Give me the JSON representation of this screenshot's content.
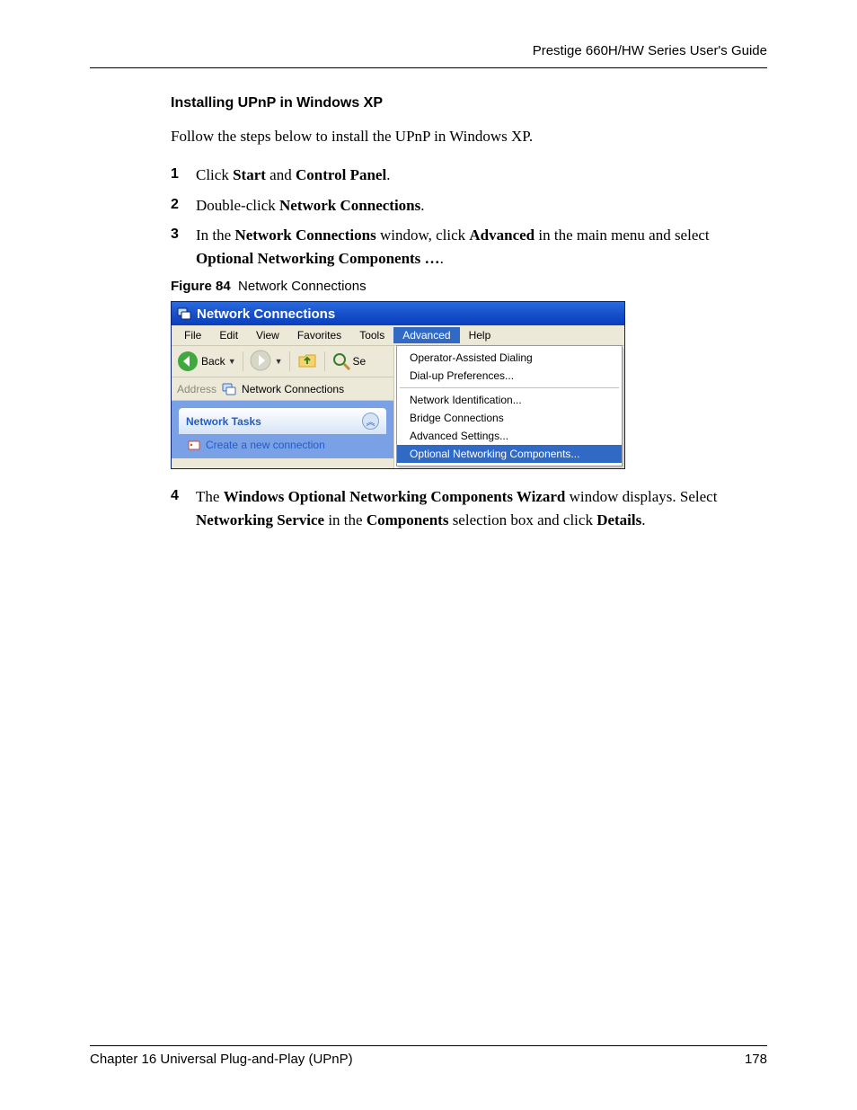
{
  "header": {
    "title": "Prestige 660H/HW Series User's Guide"
  },
  "section": {
    "heading": "Installing UPnP in Windows XP"
  },
  "intro": "Follow the steps below to install the UPnP in Windows XP.",
  "steps": {
    "s1": {
      "num": "1",
      "t1": "Click ",
      "b1": "Start",
      "t2": " and ",
      "b2": "Control Panel",
      "t3": "."
    },
    "s2": {
      "num": "2",
      "t1": "Double-click ",
      "b1": "Network Connections",
      "t2": "."
    },
    "s3": {
      "num": "3",
      "t1": "In the ",
      "b1": "Network Connections",
      "t2": " window, click ",
      "b2": "Advanced",
      "t3": " in the main menu and select ",
      "b3": "Optional Networking Components …",
      "t4": "."
    },
    "s4": {
      "num": "4",
      "t1": "The ",
      "b1": "Windows Optional Networking Components Wizard",
      "t2": " window displays. Select ",
      "b2": "Networking Service",
      "t3": " in the ",
      "b3": "Components",
      "t4": " selection box and click ",
      "b4": "Details",
      "t5": "."
    }
  },
  "figure": {
    "label": "Figure 84",
    "caption": "Network Connections"
  },
  "xp": {
    "title": "Network Connections",
    "menu": {
      "file": "File",
      "edit": "Edit",
      "view": "View",
      "favorites": "Favorites",
      "tools": "Tools",
      "advanced": "Advanced",
      "help": "Help"
    },
    "toolbar": {
      "back": "Back",
      "search_cut": "Se"
    },
    "address": {
      "label": "Address",
      "value": "Network Connections"
    },
    "taskpane": {
      "title": "Network Tasks",
      "link": "Create a new connection"
    },
    "dropdown": {
      "i1": "Operator-Assisted Dialing",
      "i2": "Dial-up Preferences...",
      "i3": "Network Identification...",
      "i4": "Bridge Connections",
      "i5": "Advanced Settings...",
      "i6": "Optional Networking Components..."
    }
  },
  "footer": {
    "chapter": "Chapter 16 Universal Plug-and-Play (UPnP)",
    "page": "178"
  }
}
